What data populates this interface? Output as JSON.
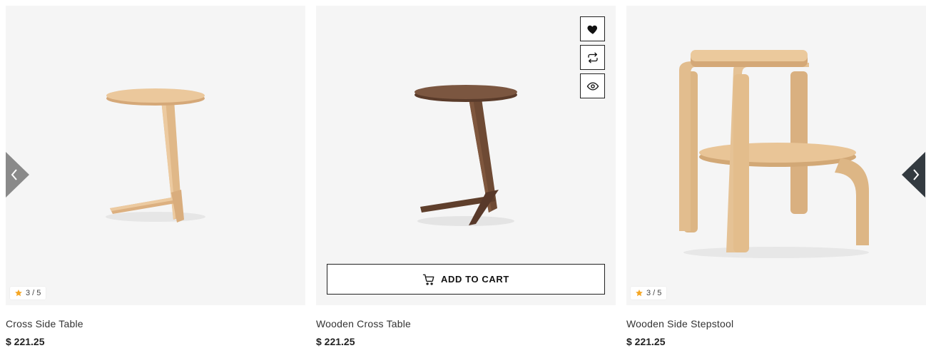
{
  "products": [
    {
      "title": "Cross Side Table",
      "price": "$ 221.25",
      "rating": "3 / 5",
      "image": "light-oak-cross-side-table"
    },
    {
      "title": "Wooden Cross Table",
      "price": "$ 221.25",
      "image": "walnut-cross-table",
      "add_to_cart_label": "ADD TO CART",
      "actions": [
        "heart-icon",
        "compare-icon",
        "eye-icon"
      ]
    },
    {
      "title": "Wooden Side Stepstool",
      "price": "$ 221.25",
      "rating": "3 / 5",
      "image": "oak-side-stepstool"
    }
  ],
  "navigation": {
    "prev_icon": "chevron-left-icon",
    "next_icon": "chevron-right-icon"
  },
  "colors": {
    "image_background": "#f5f5f5",
    "star": "#f5a623",
    "nav_prev": "#8a8a8a",
    "nav_next": "#333a40"
  }
}
